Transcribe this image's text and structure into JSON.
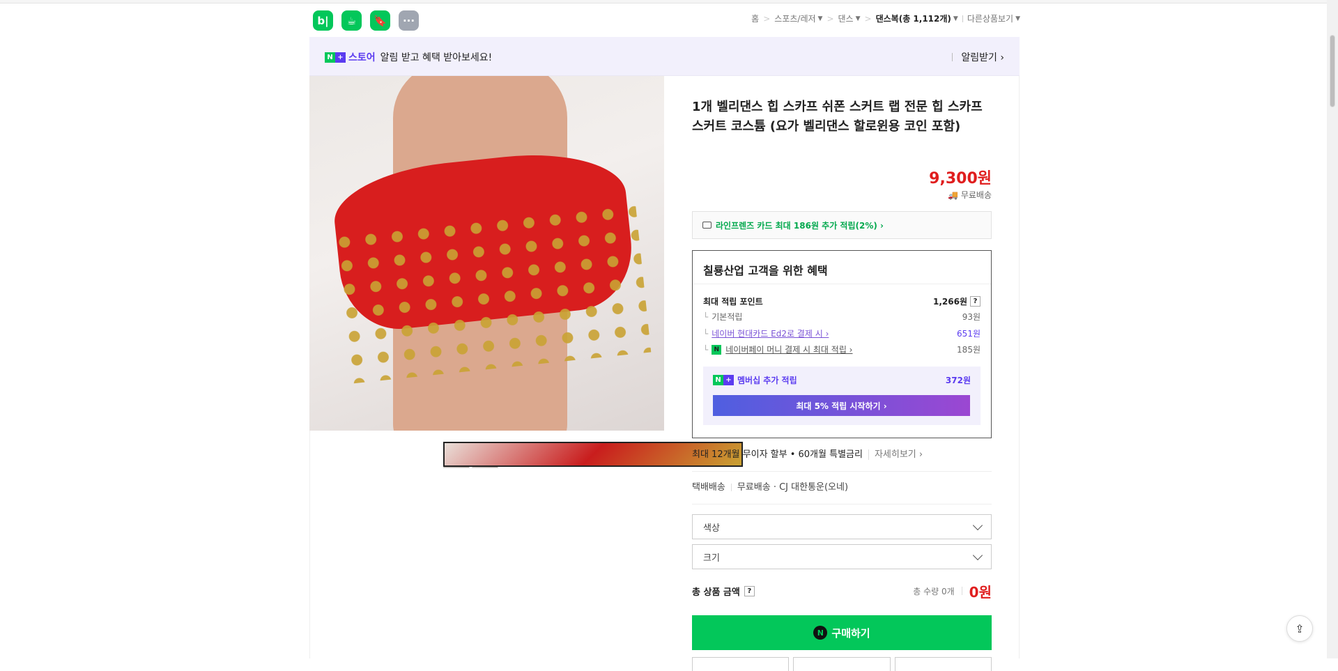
{
  "header": {
    "apps": [
      {
        "label": "b|",
        "icon": "blog-icon"
      },
      {
        "label": "☕",
        "icon": "cafe-icon"
      },
      {
        "label": "🔖",
        "icon": "bookmark-icon"
      },
      {
        "label": "···",
        "icon": "more-icon"
      }
    ],
    "breadcrumb": {
      "home": "홈",
      "sports": "스포츠/레저",
      "dance": "댄스",
      "dancewear": "댄스복(총 1,112개)",
      "other": "다른상품보기"
    }
  },
  "banner": {
    "n": "N",
    "plus": "+",
    "store": "스토어",
    "message": "알림 받고 혜택 받아보세요!",
    "cta": "알림받기 ›"
  },
  "product": {
    "title": "1개 벨리댄스 힙 스카프 쉬폰 스커트 랩 전문 힙 스카프 스커트 코스튬 (요가 벨리댄스 할로윈용 코인 포함)",
    "price": "9,300원",
    "shipping": "무료배송"
  },
  "card_offer": "라인프렌즈 카드 최대 186원 추가 적립(2%) ›",
  "benefit": {
    "heading": "칠룡산업 고객을 위한 혜택",
    "max_points_label": "최대 적립 포인트",
    "max_points_value": "1,266원",
    "help": "?",
    "basic_label": "기본적립",
    "basic_value": "93원",
    "hyundai_label": "네이버 현대카드 Ed2로 결제 시 ›",
    "hyundai_value": "651원",
    "npay_icon": "N",
    "npay_label": "네이버페이 머니 결제 시 최대 적립 ›",
    "npay_value": "185원",
    "member_label": "멤버십 추가 적립",
    "member_value": "372원",
    "member_button": "최대 5% 적립 시작하기 ›"
  },
  "installment": {
    "text": "최대 12개월 무이자 할부 • 60개월 특별금리",
    "more": "자세히보기 ›"
  },
  "delivery": {
    "type": "택배배송",
    "fee": "무료배송",
    "carrier": "· CJ 대한통운(오네)"
  },
  "options": {
    "color": "색상",
    "size": "크기"
  },
  "total": {
    "label": "총 상품 금액",
    "help": "?",
    "qty": "총 수량 0개",
    "amount": "0원"
  },
  "buy": {
    "icon": "N",
    "label": "구매하기"
  },
  "share_icon": "share-icon"
}
